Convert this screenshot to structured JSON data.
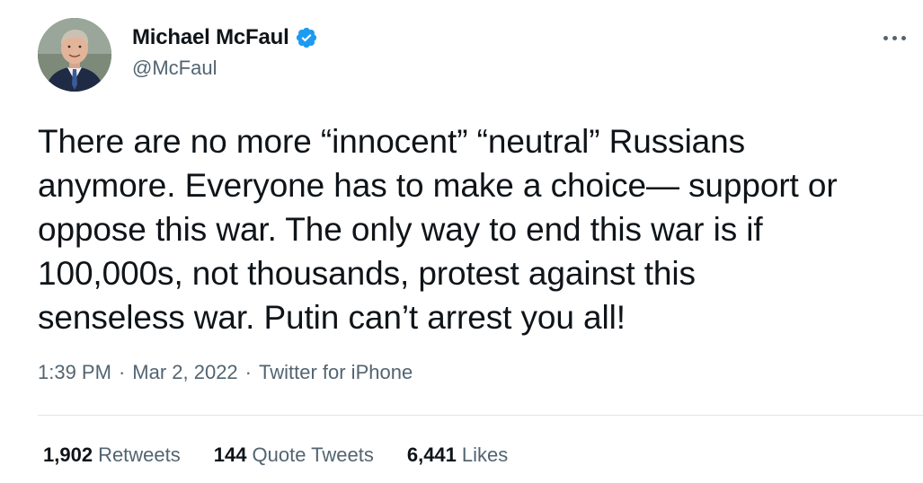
{
  "author": {
    "display_name": "Michael McFaul",
    "handle": "@McFaul",
    "verified": true,
    "avatar_icon": "profile-photo"
  },
  "tweet": {
    "text": "There are no more “innocent” “neutral” Russians\nanymore. Everyone has to make a choice— support or\noppose this war. The only way to end this war is if\n100,000s, not thousands, protest against this\nsenseless war. Putin can’t arrest you all!",
    "time": "1:39 PM",
    "separator": "·",
    "date": "Mar 2, 2022",
    "source": "Twitter for iPhone"
  },
  "stats": {
    "retweets_count": "1,902",
    "retweets_label": "Retweets",
    "quotes_count": "144",
    "quotes_label": "Quote Tweets",
    "likes_count": "6,441",
    "likes_label": "Likes"
  },
  "colors": {
    "text": "#0f1419",
    "secondary": "#536471",
    "verified": "#1d9bf0",
    "divider": "#e1e6ea"
  },
  "icons": {
    "verified": "verified-badge-icon",
    "more": "more-options-icon"
  }
}
